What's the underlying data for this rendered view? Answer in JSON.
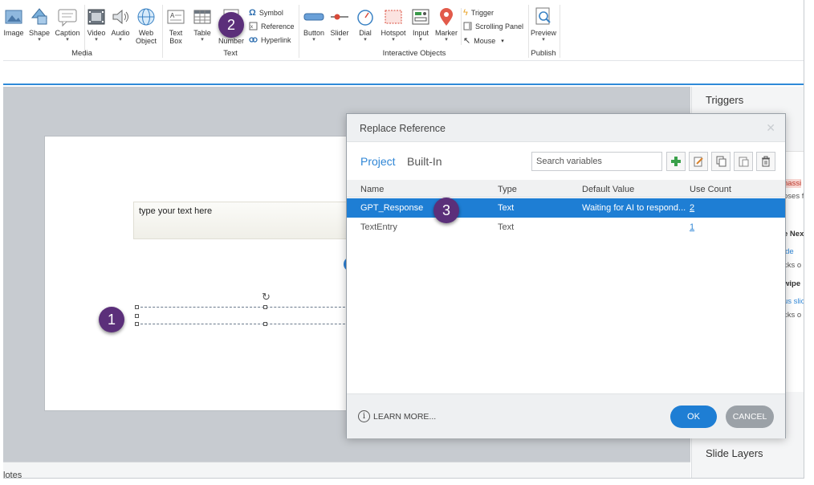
{
  "ribbon": {
    "media": [
      {
        "label": "Image",
        "icon": "image-icon"
      },
      {
        "label": "Shape",
        "icon": "shape-icon"
      },
      {
        "label": "Caption",
        "icon": "caption-icon"
      },
      {
        "label": "Video",
        "icon": "video-icon"
      },
      {
        "label": "Audio",
        "icon": "audio-icon"
      },
      {
        "label": "Web Object",
        "line1": "Web",
        "line2": "Object",
        "icon": "globe-icon"
      }
    ],
    "media_group": "Media",
    "text_items": [
      {
        "line1": "Text",
        "line2": "Box",
        "icon": "text-box-icon"
      },
      {
        "label": "Table",
        "icon": "table-icon"
      },
      {
        "line1": "Slide",
        "line2": "Number",
        "icon": "slide-number-icon"
      }
    ],
    "text_small": [
      "Symbol",
      "Reference",
      "Hyperlink"
    ],
    "text_group": "Text",
    "interactive": [
      {
        "label": "Button",
        "icon": "button-icon"
      },
      {
        "label": "Slider",
        "icon": "slider-icon"
      },
      {
        "label": "Dial",
        "icon": "dial-icon"
      },
      {
        "label": "Hotspot",
        "icon": "hotspot-icon"
      },
      {
        "label": "Input",
        "icon": "input-icon"
      },
      {
        "label": "Marker",
        "icon": "marker-icon"
      }
    ],
    "interactive_small": [
      "Trigger",
      "Scrolling Panel",
      "Mouse"
    ],
    "interactive_group": "Interactive Objects",
    "publish_item": "Preview",
    "publish_group": "Publish"
  },
  "slide": {
    "text_entry_value": "type your text here"
  },
  "notes_label": "lotes",
  "right_panel": {
    "triggers_title": "Triggers",
    "slide_layers_title": "Slide Layers",
    "fragments": [
      "nassi",
      "oses f",
      "e Nex",
      "ide",
      "cks o",
      "wipe",
      "us slic",
      "cks o"
    ]
  },
  "dialog": {
    "title": "Replace Reference",
    "tabs": [
      "Project",
      "Built-In"
    ],
    "search_placeholder": "Search variables",
    "columns": [
      "Name",
      "Type",
      "Default Value",
      "Use Count"
    ],
    "rows": [
      {
        "name": "GPT_Response",
        "type": "Text",
        "default": "Waiting for AI to respond...",
        "count": "2"
      },
      {
        "name": "TextEntry",
        "type": "Text",
        "default": "",
        "count": "1"
      }
    ],
    "learn_more": "LEARN MORE...",
    "ok": "OK",
    "cancel": "CANCEL"
  },
  "markers": [
    "1",
    "2",
    "3"
  ],
  "colors": {
    "accent": "#1e7ed4",
    "marker": "#5b2f7a",
    "workspace": "#c7cbd0"
  }
}
